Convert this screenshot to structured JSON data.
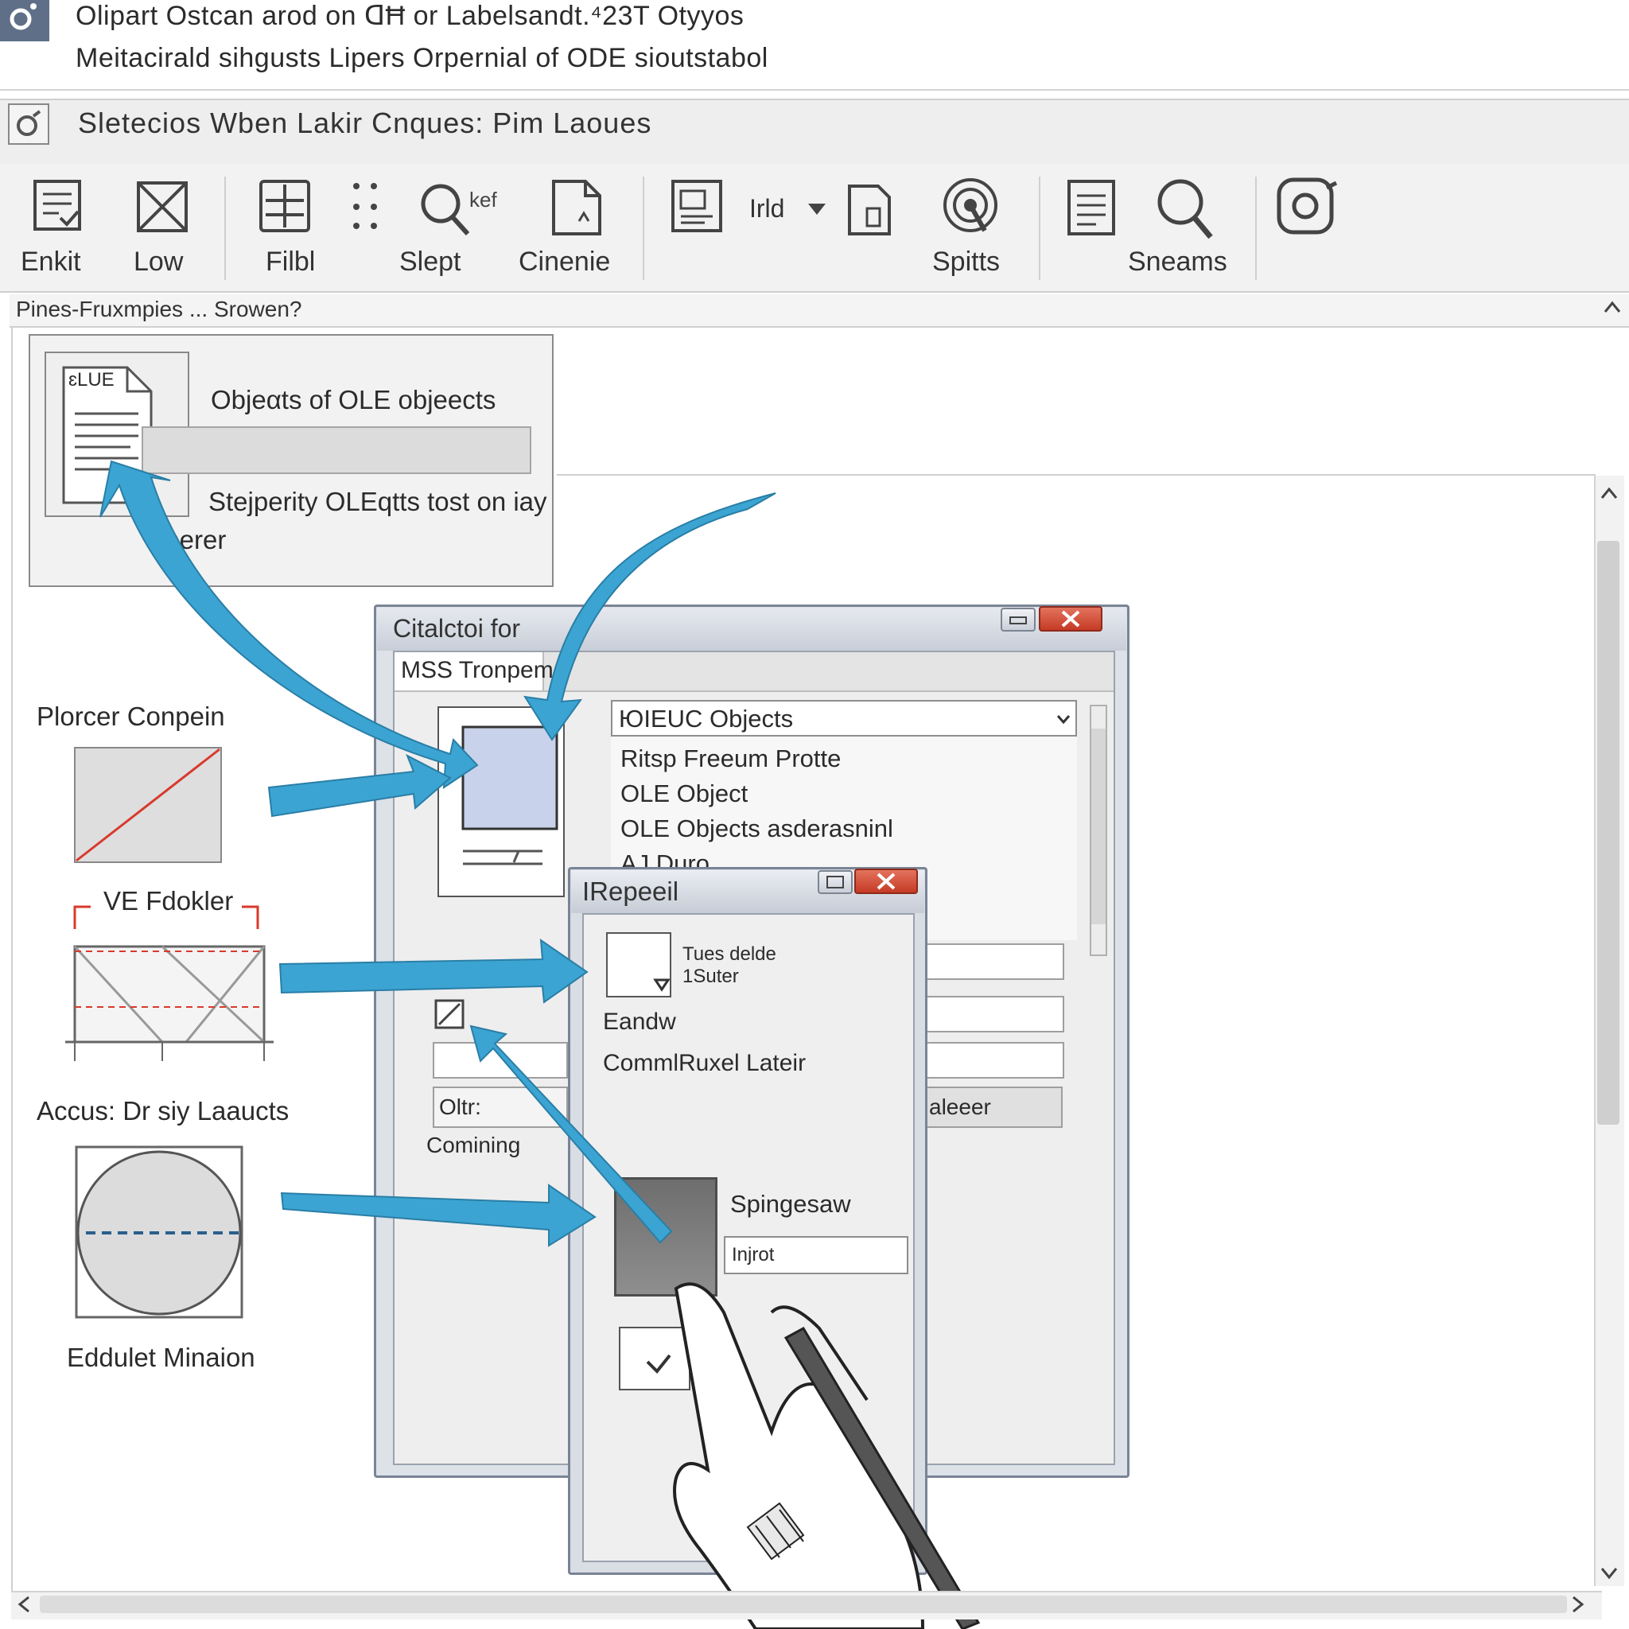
{
  "header": {
    "line1": "Olipart Ostcan arod on ᗡĦ or Labelsandt.⁴23T Otyyos",
    "line2": "Meitacirald sihgusts Lipers Orpernial of ODE sioutstabol"
  },
  "menubar": {
    "text": "Sletecios   Wben  Lakir  Cnques:  Pim  Laoues"
  },
  "ribbon": {
    "items": [
      {
        "label": "Enkit",
        "icon": "edit-doc-icon"
      },
      {
        "label": "Low",
        "icon": "image-placeholder-icon"
      },
      {
        "label": "Filbl",
        "icon": "grid-icon"
      },
      {
        "label": "Slept",
        "icon": "search-ref-icon"
      },
      {
        "label": "Cinenie",
        "icon": "document-icon"
      },
      {
        "label": "Spitts",
        "icon": "target-icon"
      },
      {
        "label": "Sneams",
        "icon": "search-icon"
      }
    ],
    "search_badge": "kef",
    "dropdown_label": "Irld"
  },
  "pathbar": {
    "text": "Pines-Fruxmpies ...  Srowen?"
  },
  "panel_top": {
    "doc_label": "ɛLUE",
    "title": "Objeαts of OLE objeects",
    "subtitle": "Stejperity OLEqtts tost on iay",
    "subtitle2": "inerer"
  },
  "side_labels": {
    "first": "Plorcer Conpein",
    "second": "VE Fdokler",
    "third": "Accus: Dr siy Laaucts",
    "fourth": "Eddulet Minaion"
  },
  "main_dialog": {
    "title": "Citalctoi for",
    "tab": "MSS Tronpem",
    "dropdown": "ЮIEUC Objects",
    "list_items": [
      "Ritsp Freeum Protte",
      "OLE Object",
      "OLE Objects asderasninl",
      "AJ Duro"
    ],
    "group_label": "Oltr:",
    "footer_label": "Comining",
    "faded_button": "aleeer"
  },
  "sub_dialog": {
    "title": "IRepeeil",
    "check_label_1": "Tues delde",
    "check_label_2": "1Suter",
    "item_1": "Eandw",
    "item_2": "CommlRuxel Lateir",
    "spin_label": "Spingesaw",
    "input_value": "Injrot"
  },
  "colors": {
    "arrow": "#3ba4d2",
    "close_button": "#d24b35",
    "accent_red": "#d83a2c"
  }
}
